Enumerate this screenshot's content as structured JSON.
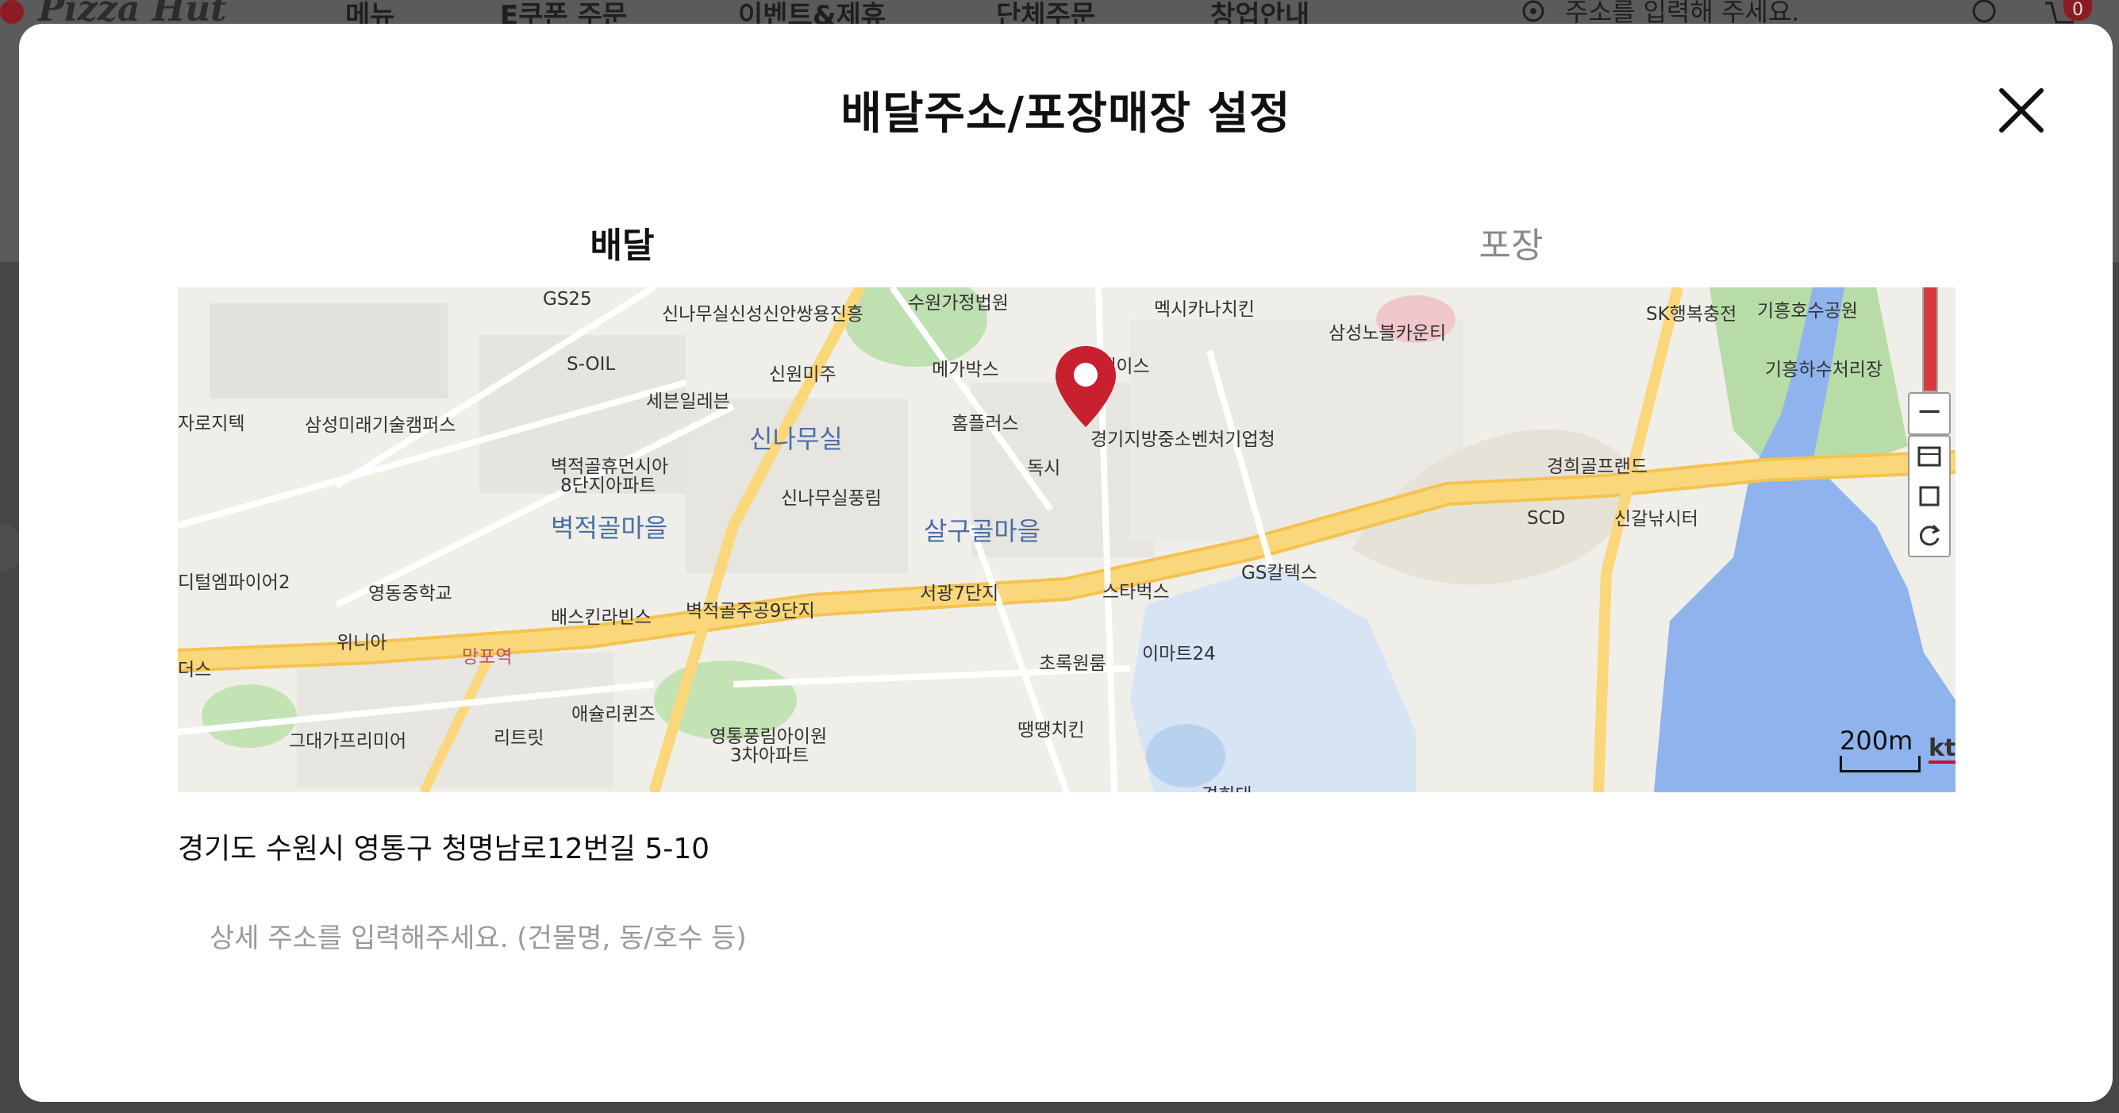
{
  "background": {
    "logo_text": "Pizza Hut",
    "nav": [
      "메뉴",
      "E쿠폰 주문",
      "이벤트&제휴",
      "단체주문",
      "창업안내"
    ],
    "address_prompt": "주소를 입력해 주세요.",
    "cart_count": "0"
  },
  "modal": {
    "title": "배달주소/포장매장 설정",
    "tabs": [
      {
        "label": "배달",
        "active": true
      },
      {
        "label": "포장",
        "active": false
      }
    ],
    "map": {
      "labels": [
        "GS25",
        "신나무실신성신안쌍용진흥",
        "수원가정법원",
        "멕시카나치킨",
        "삼성노블카운티",
        "SK행복충전",
        "기흥호수공원",
        "S-OIL",
        "신원미주",
        "메가박스",
        "플레이스",
        "기흥하수처리장",
        "세븐일레븐",
        "홈플러스",
        "자로지텍",
        "삼성미래기술캠퍼스",
        "신나무실",
        "경기지방중소벤처기업청",
        "벽적골휴먼시아",
        "8단지아파트",
        "독시",
        "경희골프랜드",
        "신나무실풍림",
        "벽적골마을",
        "살구골마을",
        "SCD",
        "신갈낚시터",
        "GS칼텍스",
        "디털엠파이어2",
        "영동중학교",
        "서광7단지",
        "스타벅스",
        "배스킨라빈스",
        "벽적골주공9단지",
        "위니아",
        "망포역",
        "초록원룸",
        "이마트24",
        "더스",
        "애슐리퀸즈",
        "영통풍림아이원",
        "3차아파트",
        "땡땡치킨",
        "그대가프리미어",
        "리트릿",
        "경희대"
      ],
      "scale": "200m",
      "provider": "kt"
    },
    "address": "경기도 수원시 영통구 청명남로12번길 5-10",
    "detail_placeholder": "상세 주소를 입력해주세요. (건물명, 동/호수 등)",
    "detail_value": ""
  }
}
